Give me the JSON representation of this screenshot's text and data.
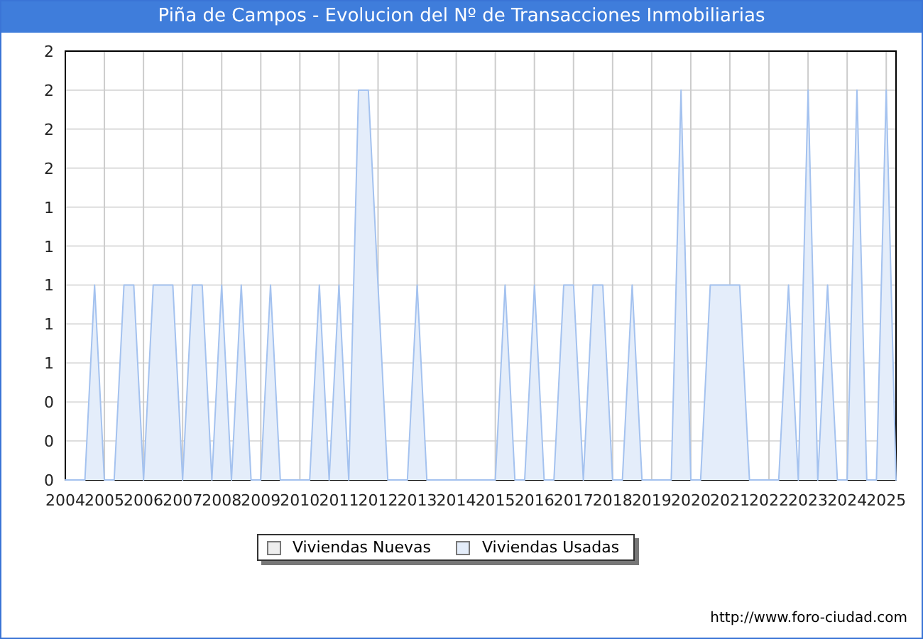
{
  "window": {
    "title": "Piña de Campos - Evolucion del Nº de Transacciones Inmobiliarias"
  },
  "chart": {
    "chart_data": {
      "type": "area",
      "x": [
        2004,
        2004.25,
        2004.5,
        2004.75,
        2005,
        2005.25,
        2005.5,
        2005.75,
        2006,
        2006.25,
        2006.5,
        2006.75,
        2007,
        2007.25,
        2007.5,
        2007.75,
        2008,
        2008.25,
        2008.5,
        2008.75,
        2009,
        2009.25,
        2009.5,
        2009.75,
        2010,
        2010.25,
        2010.5,
        2010.75,
        2011,
        2011.25,
        2011.5,
        2011.75,
        2012,
        2012.25,
        2012.5,
        2012.75,
        2013,
        2013.25,
        2013.5,
        2013.75,
        2014,
        2014.25,
        2014.5,
        2014.75,
        2015,
        2015.25,
        2015.5,
        2015.75,
        2016,
        2016.25,
        2016.5,
        2016.75,
        2017,
        2017.25,
        2017.5,
        2017.75,
        2018,
        2018.25,
        2018.5,
        2018.75,
        2019,
        2019.25,
        2019.5,
        2019.75,
        2020,
        2020.25,
        2020.5,
        2020.75,
        2021,
        2021.25,
        2021.5,
        2021.75,
        2022,
        2022.25,
        2022.5,
        2022.75,
        2023,
        2023.25,
        2023.5,
        2023.75,
        2024,
        2024.25,
        2024.5,
        2024.75,
        2025,
        2025.25
      ],
      "series": [
        {
          "name": "Viviendas Usadas",
          "color": "#a4c2ef",
          "values": [
            0,
            0,
            0,
            1,
            0,
            0,
            1,
            1,
            0,
            1,
            1,
            1,
            0,
            1,
            1,
            0,
            1,
            0,
            1,
            0,
            0,
            1,
            0,
            0,
            0,
            0,
            1,
            0,
            1,
            0,
            2,
            2,
            1,
            0,
            0,
            0,
            1,
            0,
            0,
            0,
            0,
            0,
            0,
            0,
            0,
            1,
            0,
            0,
            1,
            0,
            0,
            1,
            1,
            0,
            1,
            1,
            0,
            0,
            1,
            0,
            0,
            0,
            0,
            2,
            0,
            0,
            1,
            1,
            1,
            1,
            0,
            0,
            0,
            0,
            1,
            0,
            2,
            0,
            1,
            0,
            0,
            2,
            0,
            0,
            2,
            0
          ]
        }
      ],
      "grid": true,
      "xlim": [
        2004,
        2025.25
      ],
      "ylim": [
        0,
        2.2
      ],
      "xticks": [
        2004,
        2005,
        2006,
        2007,
        2008,
        2009,
        2010,
        2011,
        2012,
        2013,
        2014,
        2015,
        2016,
        2017,
        2018,
        2019,
        2020,
        2021,
        2022,
        2023,
        2024,
        2025
      ],
      "yticks": [
        {
          "value": 0,
          "label": "0"
        },
        {
          "value": 0.2,
          "label": "0"
        },
        {
          "value": 0.4,
          "label": "0"
        },
        {
          "value": 0.6,
          "label": "1"
        },
        {
          "value": 0.8,
          "label": "1"
        },
        {
          "value": 1,
          "label": "1"
        },
        {
          "value": 1.2,
          "label": "1"
        },
        {
          "value": 1.4,
          "label": "1"
        },
        {
          "value": 1.6,
          "label": "2"
        },
        {
          "value": 1.8,
          "label": "2"
        },
        {
          "value": 2,
          "label": "2"
        },
        {
          "value": 2.2,
          "label": "2"
        }
      ]
    }
  },
  "legend": [
    {
      "label": "Viviendas Nuevas",
      "color": "#eeeeee"
    }
  ],
  "footer": {
    "url": "http://www.foro-ciudad.com"
  }
}
